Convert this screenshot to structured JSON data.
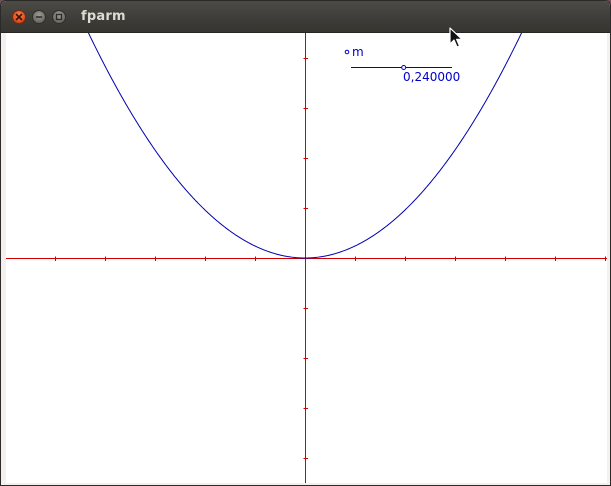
{
  "window": {
    "title": "fparm"
  },
  "slider": {
    "label": "m",
    "value": 0.24,
    "value_text": "0,240000"
  },
  "colors": {
    "axis": "#d40000",
    "curve": "#0000b0",
    "slider": "#0000cc"
  },
  "icons": {
    "close": "close-icon",
    "minimize": "minimize-icon",
    "maximize": "maximize-icon",
    "cursor": "mouse-pointer-icon"
  }
}
